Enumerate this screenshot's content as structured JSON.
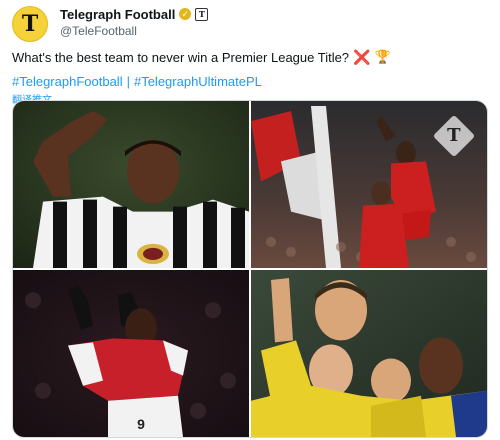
{
  "account": {
    "display_name": "Telegraph Football",
    "handle": "@TeleFootball",
    "avatar_letter": "T",
    "affiliate_letter": "T"
  },
  "tweet": {
    "text": "What's the best team to never win a Premier League Title?",
    "emoji_cross": "❌",
    "emoji_trophy": "🏆",
    "hashtag_1": "#TelegraphFootball",
    "separator": "|",
    "hashtag_2": "#TelegraphUltimatePL",
    "translate_label": "翻译推文"
  },
  "media": {
    "watermark_letter": "T",
    "images": [
      "newcastle-player-celebrating",
      "liverpool-players-celebrating",
      "arsenal-player-celebrating",
      "arsenal-players-celebrating"
    ]
  },
  "colors": {
    "link": "#1d9bf0",
    "avatar_bg": "#f6d23a",
    "verified_gold": "#e2b719",
    "text": "#0f1419",
    "muted": "#536471"
  }
}
